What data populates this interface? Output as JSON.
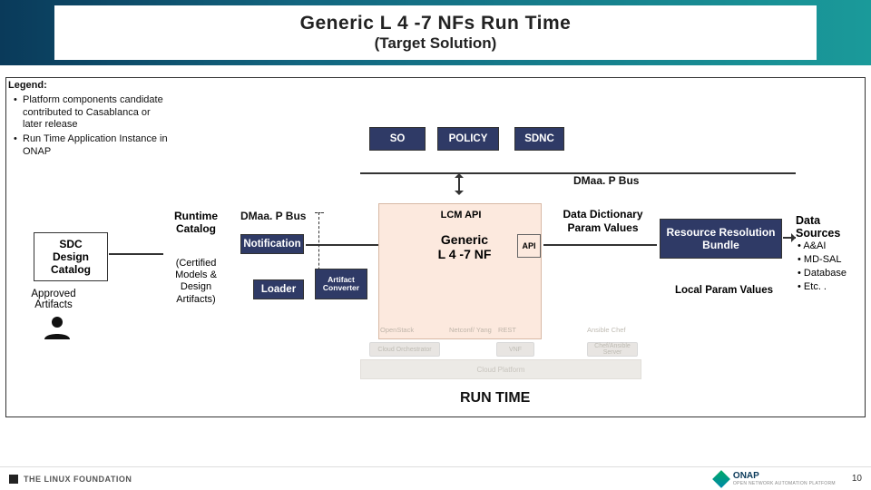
{
  "header": {
    "title": "Generic L 4 -7 NFs Run Time",
    "subtitle": "(Target Solution)"
  },
  "legend": {
    "heading": "Legend:",
    "items": [
      "Platform components candidate contributed to Casablanca or later release",
      "Run Time Application Instance in ONAP"
    ]
  },
  "top": {
    "so": "SO",
    "policy": "POLICY",
    "sdnc": "SDNC",
    "dmaap_bus": "DMaa. P Bus"
  },
  "left": {
    "sdc": "SDC\nDesign\nCatalog",
    "approved": "Approved\nArtifacts",
    "runtime_catalog": "Runtime Catalog",
    "runtime_sub": "(Certified Models & Design Artifacts)",
    "notification": "Notification",
    "loader": "Loader",
    "dmaap_bus": "DMaa. P Bus",
    "artifact_converter": "Artifact Converter"
  },
  "center": {
    "lcm_api": "LCM API",
    "generic": "Generic\nL 4 -7 NF",
    "api": "API"
  },
  "right": {
    "dd": "Data Dictionary Param Values",
    "rrb": "Resource Resolution Bundle",
    "local_param": "Local Param Values",
    "data_sources_hd": "Data Sources",
    "ds": [
      "A&AI",
      "MD-SAL",
      "Database",
      "Etc. ."
    ]
  },
  "ghosts": {
    "openstack": "OpenStack",
    "cloud_orch": "Cloud Orchestrator",
    "netconf": "Netconf/ Yang",
    "rest": "REST",
    "vnf": "VNF",
    "ansible": "Ansible Chef",
    "chef": "Chef/Ansible Server",
    "cloud_platform": "Cloud Platform"
  },
  "footer": {
    "runtime": "RUN TIME",
    "linux": "THE LINUX FOUNDATION",
    "onap": "ONAP",
    "onap_sub": "OPEN NETWORK AUTOMATION PLATFORM",
    "page": "10"
  }
}
